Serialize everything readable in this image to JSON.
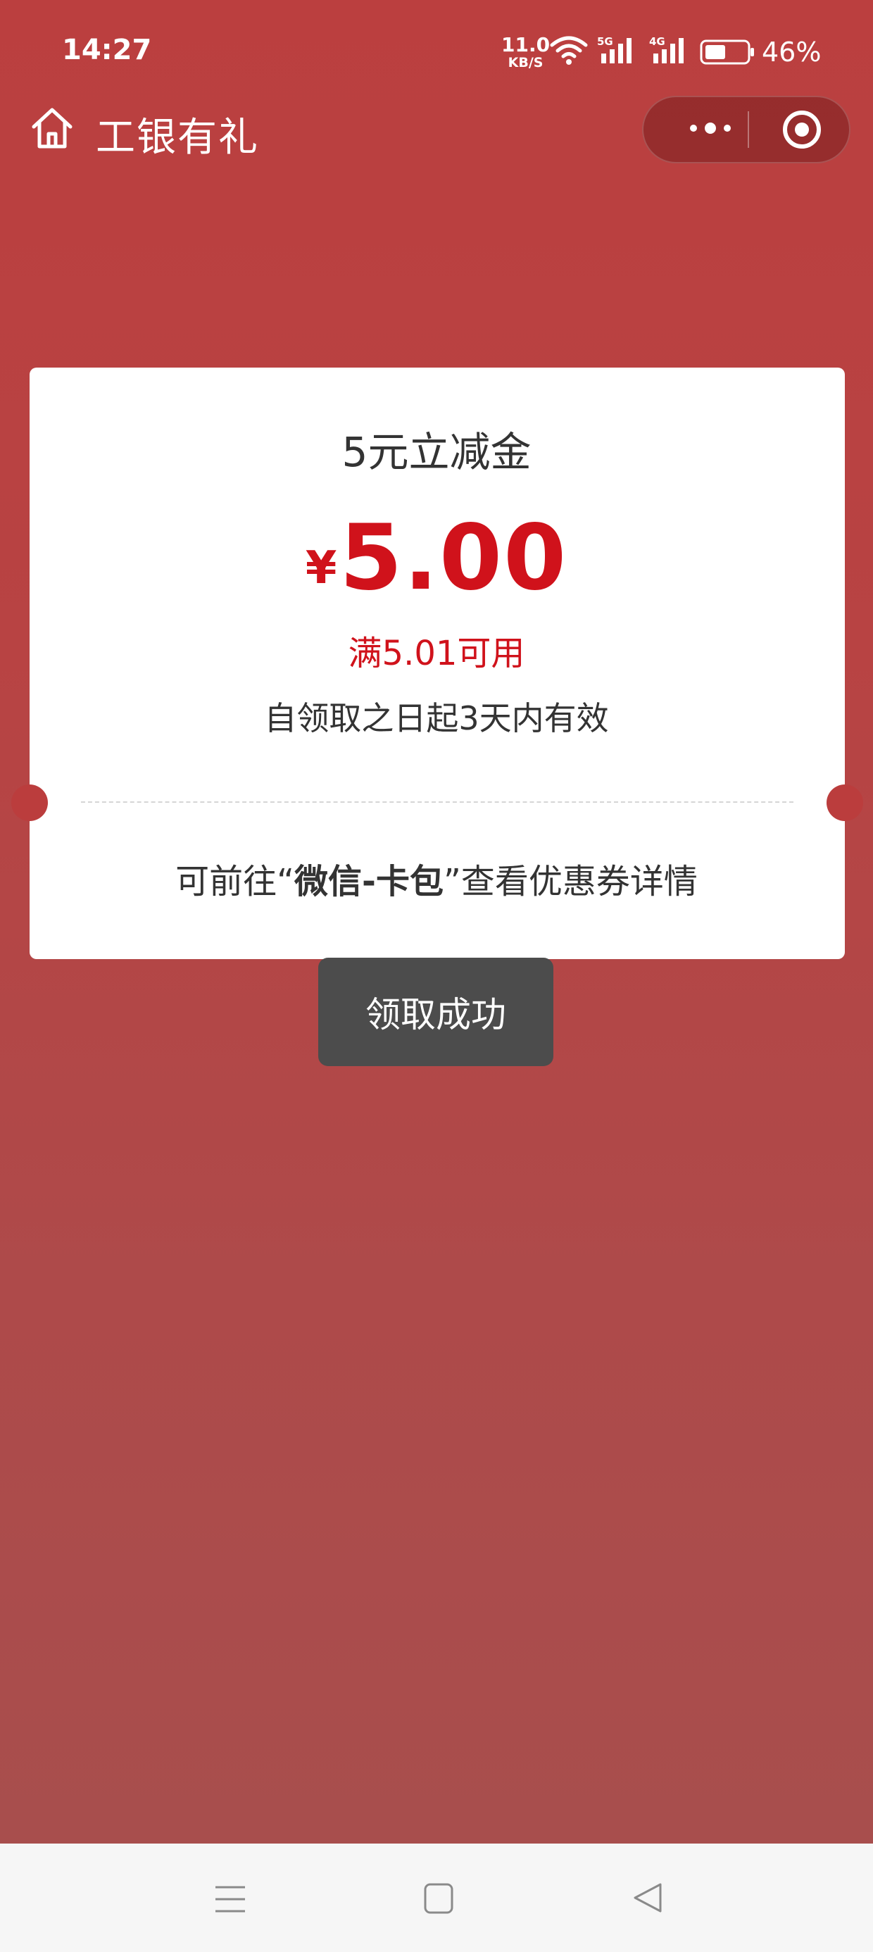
{
  "status": {
    "time": "14:27",
    "net_speed_value": "11.0",
    "net_speed_unit": "KB/S",
    "battery": "46%",
    "icons": [
      "wifi-icon",
      "signal-5g-icon",
      "signal-4g-icon",
      "battery-icon"
    ]
  },
  "nav": {
    "title": "工银有礼",
    "home_icon": "home-icon",
    "more_icon": "more-icon",
    "close_icon": "target-icon"
  },
  "coupon": {
    "name": "5元立减金",
    "currency": "¥",
    "amount": "5.00",
    "condition": "满5.01可用",
    "validity": "自领取之日起3天内有效",
    "hint_prefix": "可前往“",
    "hint_bold": "微信-卡包",
    "hint_suffix": "”查看优惠券详情"
  },
  "toast": {
    "message": "领取成功"
  },
  "system_nav": {
    "icons": [
      "menu-icon",
      "home-square-icon",
      "back-triangle-icon"
    ]
  },
  "colors": {
    "background": "#bb3f3f",
    "accent_red": "#d0121b",
    "toast_bg": "#4c4c4c"
  }
}
